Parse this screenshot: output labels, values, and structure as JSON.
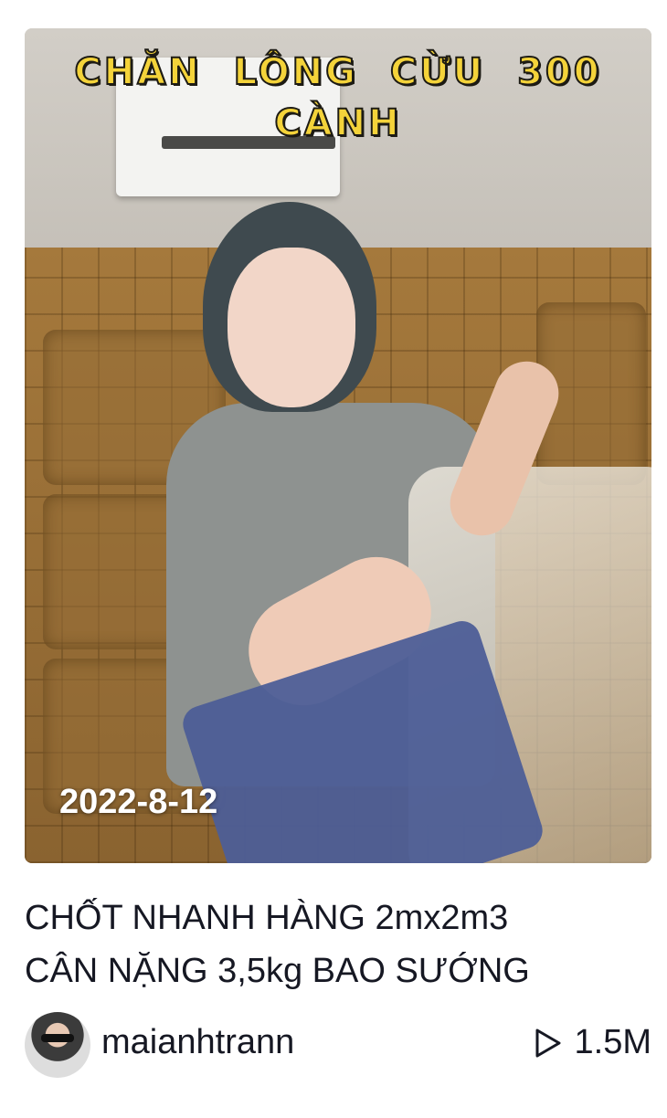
{
  "video": {
    "overlay_title": "CHĂN LÔNG CỪU 300 CÀNH",
    "date_stamp": "2022-8-12"
  },
  "caption": {
    "line1": "CHỐT NHANH HÀNG 2mx2m3",
    "line2": "CÂN NẶNG 3,5kg BAO SƯỚNG"
  },
  "author": {
    "username": "maianhtrann"
  },
  "stats": {
    "views": "1.5M",
    "play_icon": "play-outline-icon"
  },
  "colors": {
    "overlay_text": "#f4d33a",
    "text": "#161823"
  }
}
